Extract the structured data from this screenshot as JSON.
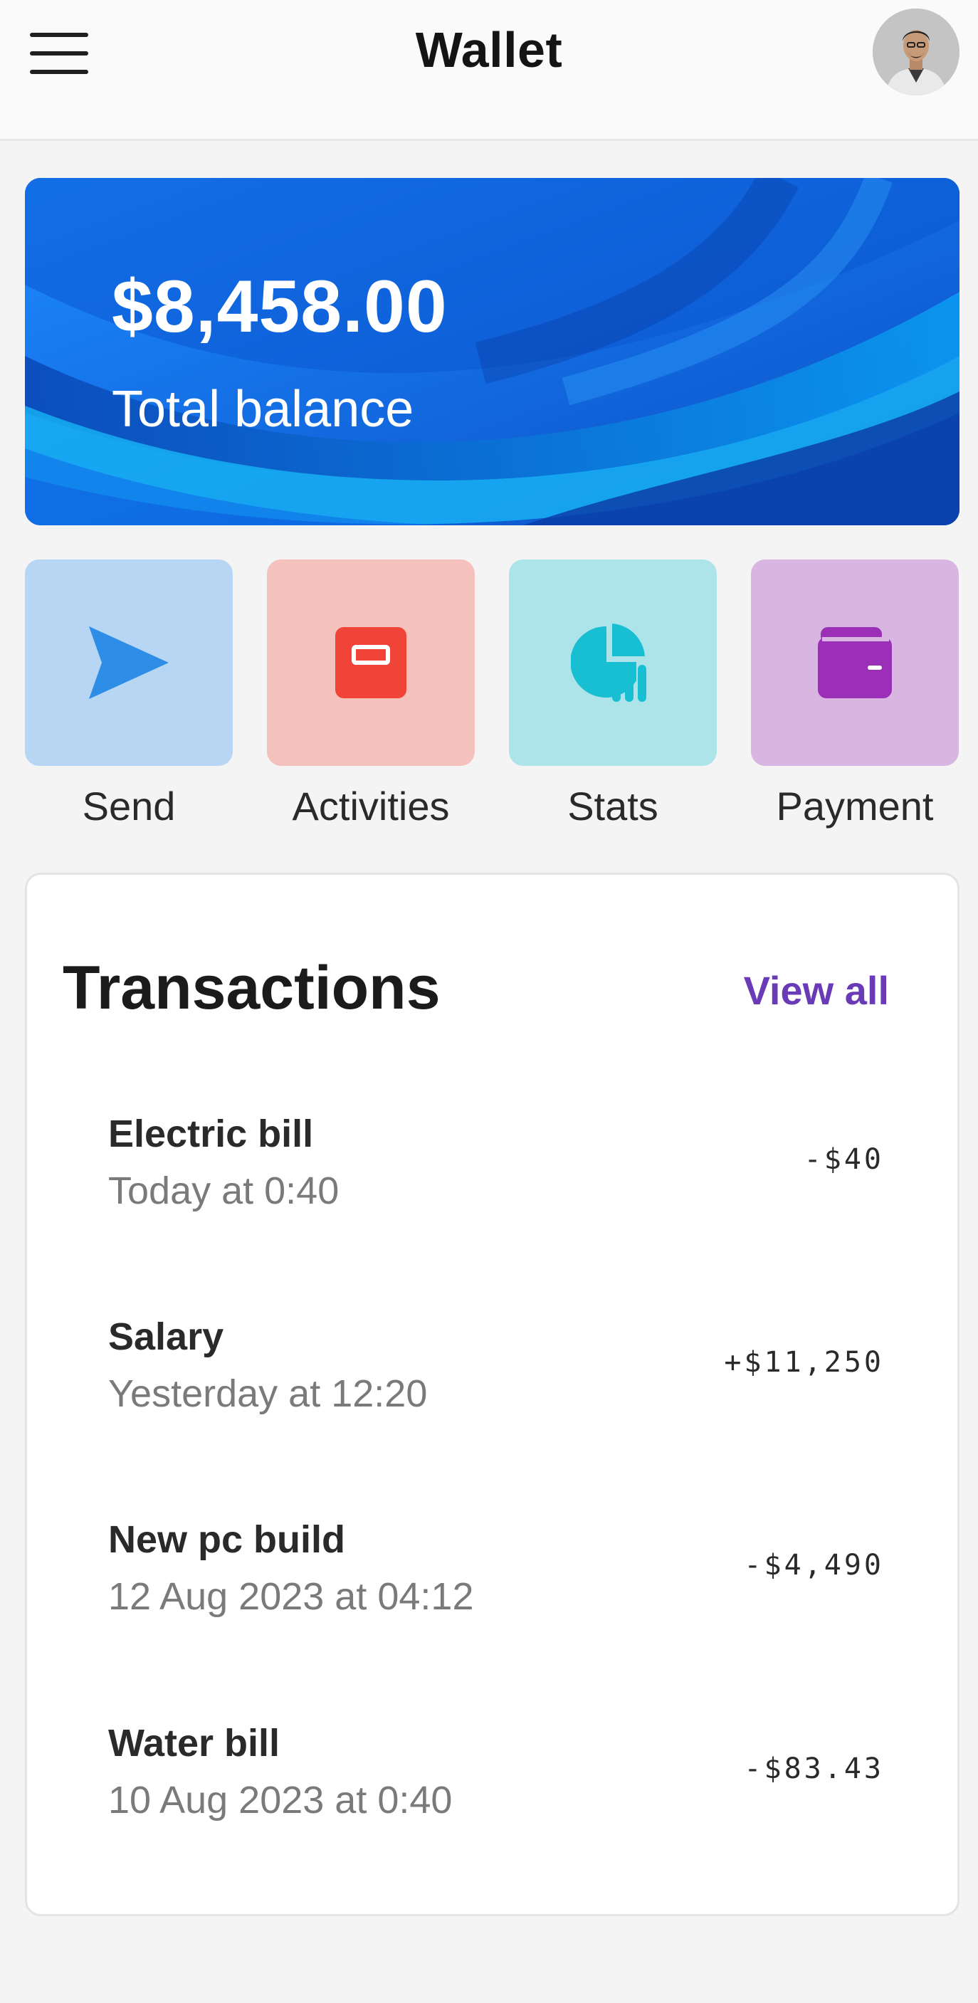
{
  "header": {
    "title": "Wallet",
    "menu_icon": "hamburger-menu-icon",
    "avatar_icon": "user-avatar"
  },
  "balance": {
    "amount": "$8,458.00",
    "label": "Total balance"
  },
  "actions": [
    {
      "label": "Send",
      "icon": "send-icon",
      "tile_color": "#b6d6f3",
      "icon_color": "#2e8de6"
    },
    {
      "label": "Activities",
      "icon": "card-icon",
      "tile_color": "#f4c1bd",
      "icon_color": "#f04438"
    },
    {
      "label": "Stats",
      "icon": "stats-icon",
      "tile_color": "#ade4ea",
      "icon_color": "#18bfd2"
    },
    {
      "label": "Payment",
      "icon": "wallet-icon",
      "tile_color": "#d9b6e1",
      "icon_color": "#9c2fb8"
    }
  ],
  "transactions": {
    "title": "Transactions",
    "view_all": "View all",
    "items": [
      {
        "name": "Electric bill",
        "time": "Today at 0:40",
        "amount": "-$40"
      },
      {
        "name": "Salary",
        "time": "Yesterday at 12:20",
        "amount": "+$11,250"
      },
      {
        "name": "New pc build",
        "time": "12 Aug 2023 at 04:12",
        "amount": "-$4,490"
      },
      {
        "name": "Water bill",
        "time": "10 Aug 2023 at 0:40",
        "amount": "-$83.43"
      }
    ]
  }
}
